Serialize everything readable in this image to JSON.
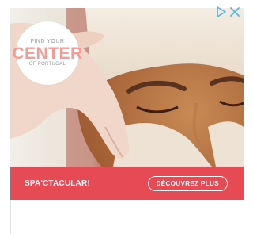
{
  "logo": {
    "line1": "FIND YOUR",
    "line2": "CENTER",
    "line3": "OF PORTUGAL"
  },
  "banner": {
    "tagline": "SPA'CTACULAR!",
    "cta_label": "DÉCOUVREZ PLUS"
  },
  "adchoices": {
    "info_icon": "adchoices-triangle-icon",
    "close_icon": "close-icon"
  },
  "colors": {
    "banner": "#e64a54",
    "logo_accent": "#f59b96",
    "adchoices": "#4fb8e6"
  }
}
